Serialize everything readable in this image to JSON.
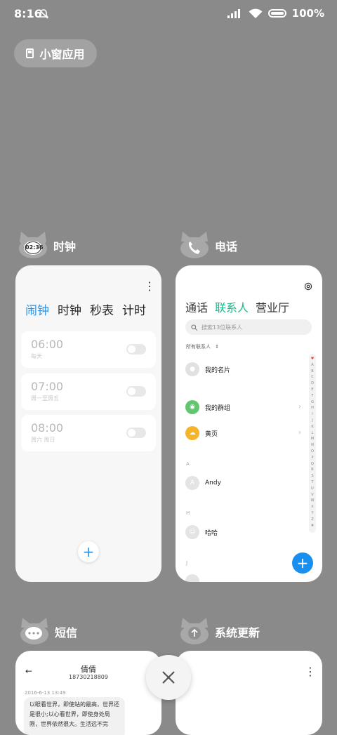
{
  "status": {
    "time": "8:16",
    "battery": "100%"
  },
  "float_label": "小窗应用",
  "apps": {
    "clock": {
      "name": "时钟",
      "icon_time": "02:36",
      "tabs": [
        "闹钟",
        "时钟",
        "秒表",
        "计时"
      ],
      "alarms": [
        {
          "time": "06:00",
          "repeat": "每天"
        },
        {
          "time": "07:00",
          "repeat": "周一至周五"
        },
        {
          "time": "08:00",
          "repeat": "周六 周日"
        }
      ]
    },
    "phone": {
      "name": "电话",
      "tabs": [
        "通话",
        "联系人",
        "营业厅"
      ],
      "search_placeholder": "搜索13位联系人",
      "filter": "所有联系人",
      "rows": [
        "我的名片",
        "我的群组",
        "黄页"
      ],
      "sections": [
        "A",
        "H",
        "J"
      ],
      "contacts": {
        "a": "Andy",
        "h": "哈哈",
        "a_initial": "A"
      },
      "alphabet": [
        "♥",
        "A",
        "B",
        "C",
        "D",
        "E",
        "F",
        "G",
        "H",
        "I",
        "J",
        "K",
        "L",
        "M",
        "N",
        "O",
        "P",
        "Q",
        "R",
        "S",
        "T",
        "U",
        "V",
        "W",
        "X",
        "Y",
        "Z",
        "#"
      ]
    },
    "sms": {
      "name": "短信",
      "contact": "倩倩",
      "number": "18730218809",
      "date": "2016-6-13 13:49",
      "message": "以眼看世界，即使站的最高，世界还是很小;以心看世界，即使身处局限，世界依然很大。生活远不完"
    },
    "update": {
      "name": "系统更新"
    }
  },
  "colors": {
    "active_blue": "#2b95e8",
    "active_green": "#1fb78b",
    "fab_blue": "#1990ef"
  }
}
